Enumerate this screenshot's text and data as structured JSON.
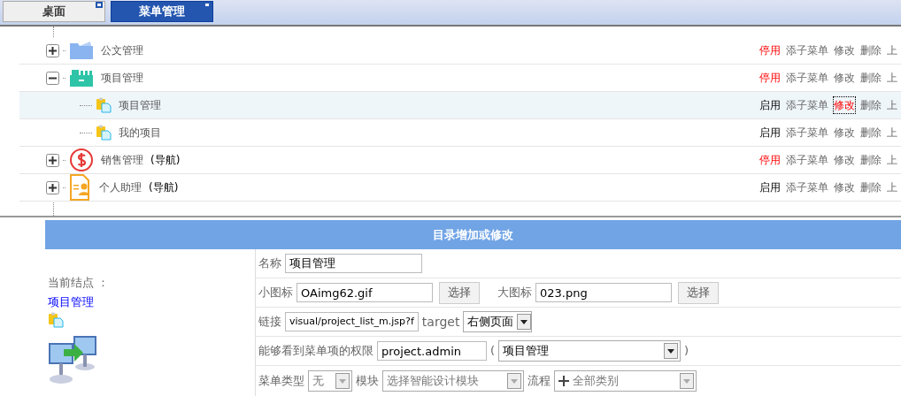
{
  "tabs": [
    {
      "label": "桌面",
      "selected": false
    },
    {
      "label": "菜单管理",
      "selected": true
    }
  ],
  "tree": [
    {
      "label": "公文管理",
      "expanded": false,
      "selected": false,
      "actions": [
        {
          "label": "停用",
          "kind": "toggle-red",
          "focused": false
        },
        {
          "label": "添子菜单",
          "kind": "plain",
          "focused": false
        },
        {
          "label": "修改",
          "kind": "plain",
          "focused": false
        },
        {
          "label": "删除",
          "kind": "plain",
          "focused": false
        },
        {
          "label": "上",
          "kind": "plain",
          "focused": false
        }
      ]
    },
    {
      "label": "项目管理",
      "expanded": true,
      "selected": false,
      "actions": [
        {
          "label": "停用",
          "kind": "toggle-red",
          "focused": false
        },
        {
          "label": "添子菜单",
          "kind": "plain",
          "focused": false
        },
        {
          "label": "修改",
          "kind": "plain",
          "focused": false
        },
        {
          "label": "删除",
          "kind": "plain",
          "focused": false
        },
        {
          "label": "上",
          "kind": "plain",
          "focused": false
        }
      ],
      "children": [
        {
          "label": "项目管理",
          "selected": true,
          "actions": [
            {
              "label": "启用",
              "kind": "toggle-black",
              "focused": false
            },
            {
              "label": "添子菜单",
              "kind": "plain",
              "focused": false
            },
            {
              "label": "修改",
              "kind": "plain",
              "focused": true
            },
            {
              "label": "删除",
              "kind": "plain",
              "focused": false
            },
            {
              "label": "上",
              "kind": "plain",
              "focused": false
            }
          ]
        },
        {
          "label": "我的项目",
          "selected": false,
          "actions": [
            {
              "label": "启用",
              "kind": "toggle-black",
              "focused": false
            },
            {
              "label": "添子菜单",
              "kind": "plain",
              "focused": false
            },
            {
              "label": "修改",
              "kind": "plain",
              "focused": false
            },
            {
              "label": "删除",
              "kind": "plain",
              "focused": false
            },
            {
              "label": "上",
              "kind": "plain",
              "focused": false
            }
          ]
        }
      ]
    },
    {
      "label": "销售管理",
      "suffix": "(导航)",
      "expanded": false,
      "selected": false,
      "actions": [
        {
          "label": "停用",
          "kind": "toggle-red",
          "focused": false
        },
        {
          "label": "添子菜单",
          "kind": "plain",
          "focused": false
        },
        {
          "label": "修改",
          "kind": "plain",
          "focused": false
        },
        {
          "label": "删除",
          "kind": "plain",
          "focused": false
        },
        {
          "label": "上",
          "kind": "plain",
          "focused": false
        }
      ]
    },
    {
      "label": "个人助理",
      "suffix": "(导航)",
      "expanded": false,
      "selected": false,
      "actions": [
        {
          "label": "启用",
          "kind": "toggle-black",
          "focused": false
        },
        {
          "label": "添子菜单",
          "kind": "plain",
          "focused": false
        },
        {
          "label": "修改",
          "kind": "plain",
          "focused": false
        },
        {
          "label": "删除",
          "kind": "plain",
          "focused": false
        },
        {
          "label": "上",
          "kind": "plain",
          "focused": false
        }
      ]
    }
  ],
  "form": {
    "title": "目录增加或修改",
    "current_label": "当前结点 ：",
    "current_link": "项目管理",
    "name_label": "名称",
    "name_value": "项目管理",
    "small_icon_label": "小图标",
    "small_icon_value": "OAimg62.gif",
    "small_icon_button": "选择",
    "big_icon_label": "大图标",
    "big_icon_value": "023.png",
    "big_icon_button": "选择",
    "link_label": "链接",
    "link_value": "visual/project_list_m.jsp?f",
    "target_label": "target",
    "target_value": "右侧页面",
    "permission_label": "能够看到菜单项的权限",
    "permission_value": "project.admin",
    "paren_open": "(",
    "permission_select": "项目管理",
    "paren_close": ")",
    "type_label": "菜单类型",
    "type_value": "无",
    "module_label": "模块",
    "module_value": "选择智能设计模块",
    "flow_label": "流程",
    "flow_value": "全部类别"
  }
}
